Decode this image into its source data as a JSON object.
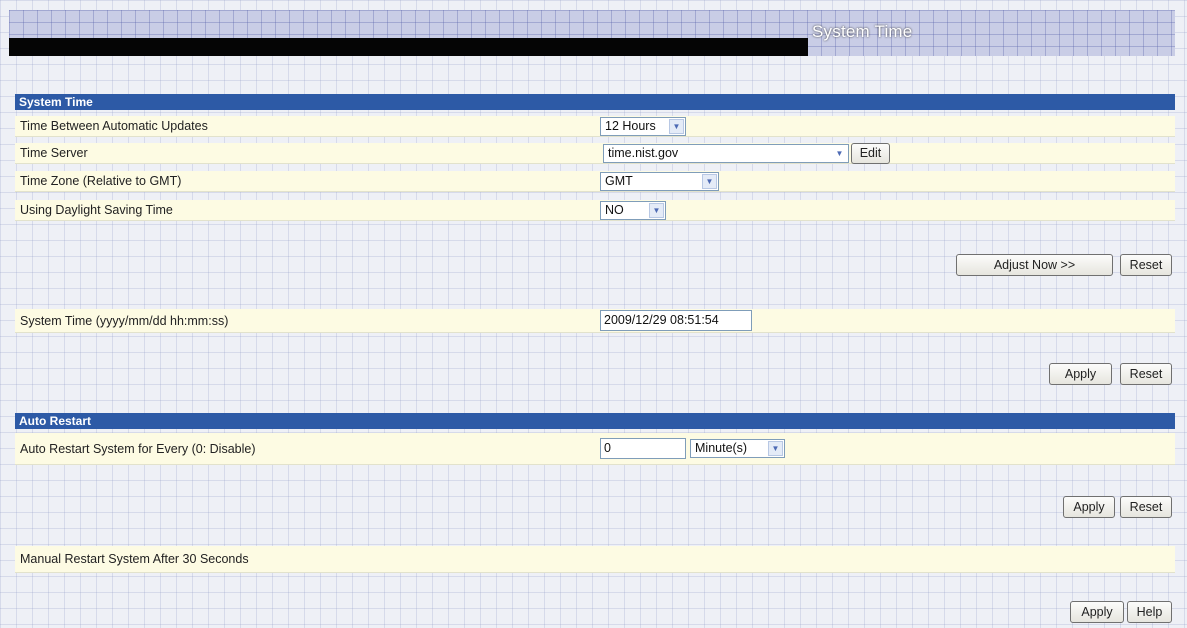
{
  "header": {
    "title": "System Time"
  },
  "system_time_section": {
    "title": "System Time",
    "rows": [
      {
        "label": "Time Between Automatic Updates",
        "value": "12 Hours"
      },
      {
        "label": "Time Server",
        "value": "time.nist.gov",
        "edit_label": "Edit"
      },
      {
        "label": "Time Zone (Relative to GMT)",
        "value": "GMT"
      },
      {
        "label": "Using Daylight Saving Time",
        "value": "NO"
      }
    ],
    "adjust_label": "Adjust Now >>",
    "reset_label": "Reset"
  },
  "manual_time": {
    "label": "System Time (yyyy/mm/dd hh:mm:ss)",
    "value": "2009/12/29 08:51:54",
    "apply_label": "Apply",
    "reset_label": "Reset"
  },
  "auto_restart": {
    "title": "Auto Restart",
    "label": "Auto Restart System for Every (0: Disable)",
    "value": "0",
    "unit": "Minute(s)",
    "apply_label": "Apply",
    "reset_label": "Reset"
  },
  "manual_restart": {
    "label": "Manual Restart System After 30 Seconds",
    "apply_label": "Apply",
    "help_label": "Help"
  },
  "icons": {
    "dropdown": "chevron-down-icon"
  }
}
